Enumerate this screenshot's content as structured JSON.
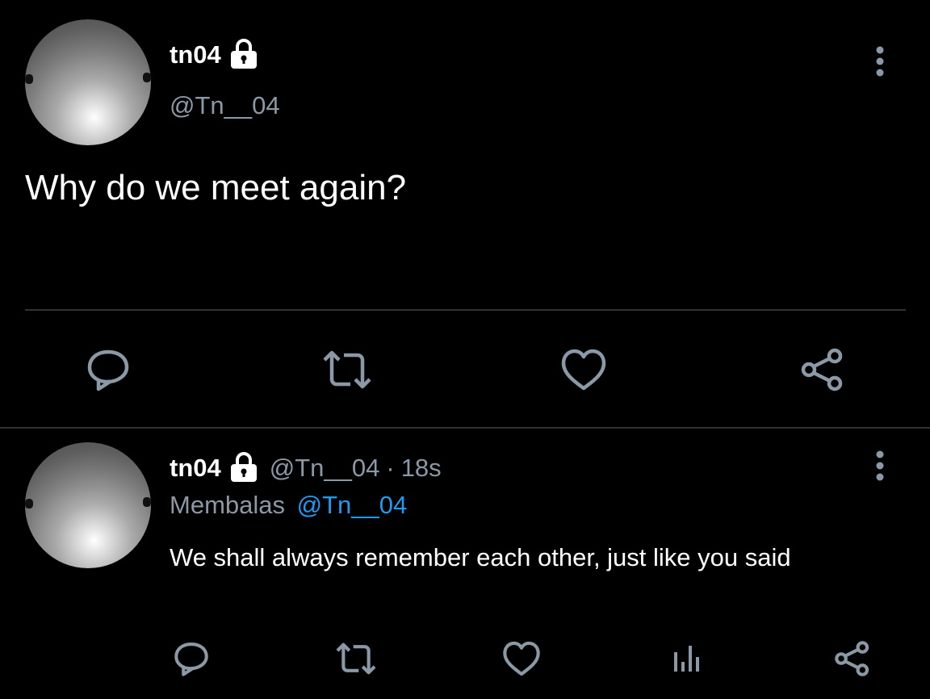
{
  "main_tweet": {
    "display_name": "tn04",
    "handle": "@Tn__04",
    "text": "Why do we meet again?",
    "icons": {
      "lock": "lock-icon",
      "more": "more-vertical-icon",
      "reply": "reply-icon",
      "retweet": "retweet-icon",
      "like": "like-icon",
      "share": "share-icon"
    }
  },
  "reply_tweet": {
    "display_name": "tn04",
    "handle": "@Tn__04",
    "separator": "·",
    "time": "18s",
    "replying_label": "Membalas",
    "replying_to": "@Tn__04",
    "text": "We shall always remember each other, just like you said",
    "icons": {
      "lock": "lock-icon",
      "more": "more-vertical-icon",
      "reply": "reply-icon",
      "retweet": "retweet-icon",
      "like": "like-icon",
      "analytics": "analytics-icon",
      "share": "share-icon"
    }
  },
  "colors": {
    "background": "#000000",
    "text": "#ffffff",
    "muted": "#8b98a5",
    "accent": "#1d9bf0",
    "divider": "#2f3336"
  }
}
